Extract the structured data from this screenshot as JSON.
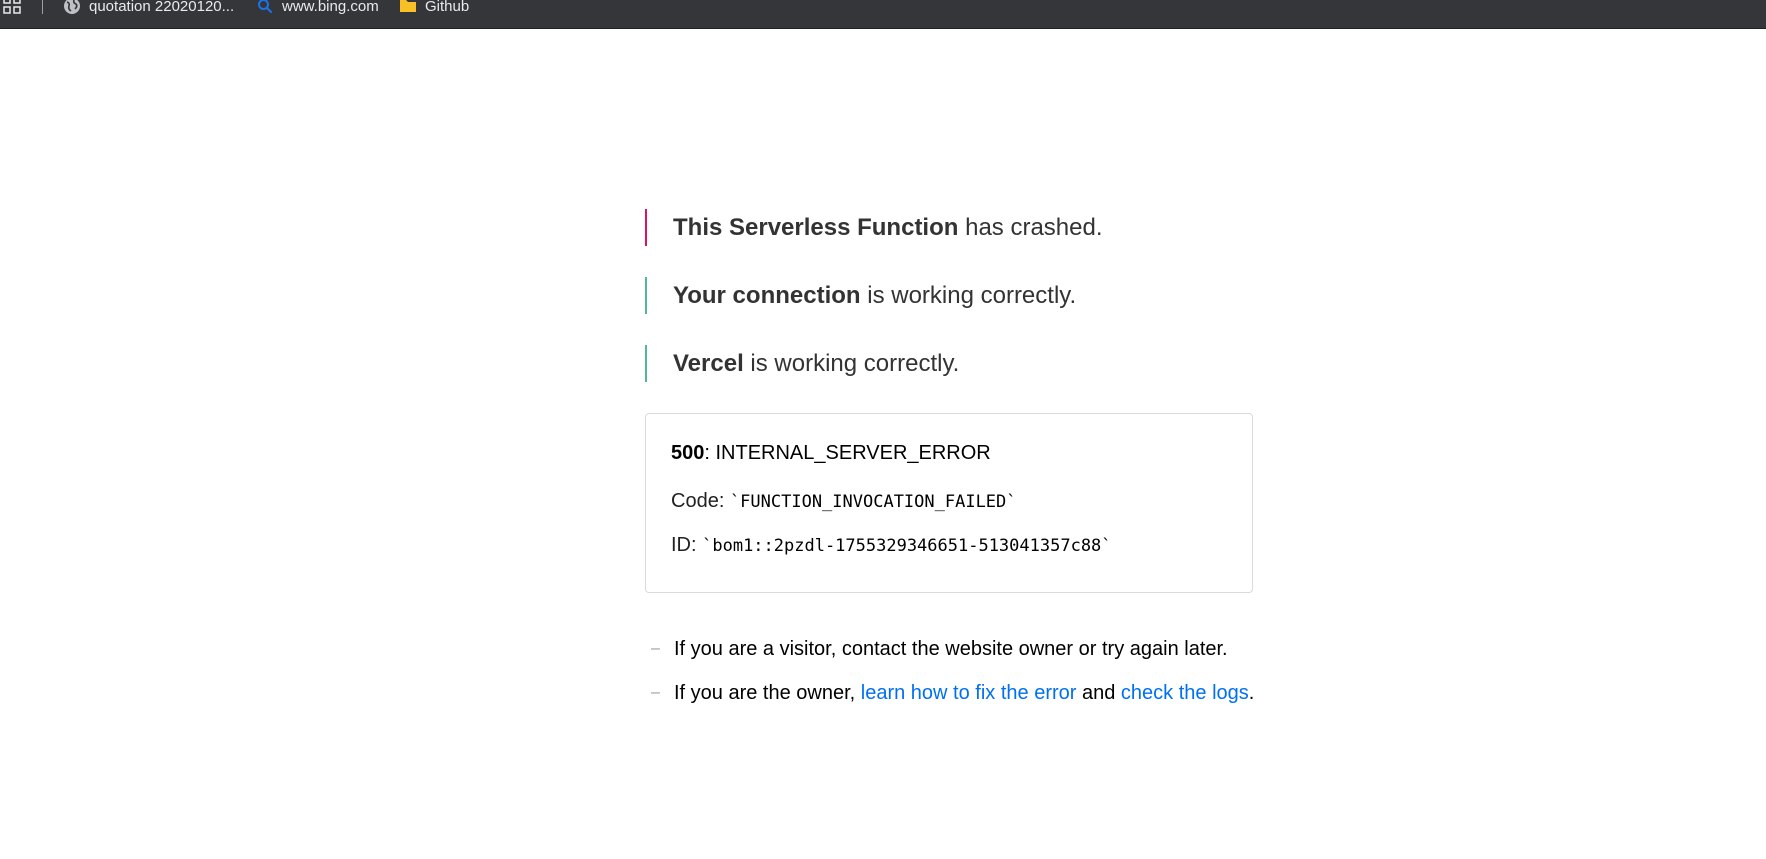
{
  "bookmarks_bar": {
    "items": [
      {
        "label": "quotation 22020120...",
        "icon": "globe-icon"
      },
      {
        "label": "www.bing.com",
        "icon": "search-icon"
      },
      {
        "label": "Github",
        "icon": "folder-icon"
      }
    ],
    "colors": {
      "bar_background": "#35363a",
      "text": "#e8eaed",
      "search_icon": "#1a73e8",
      "folder_icon": "#f6c026"
    }
  },
  "statuses": [
    {
      "bold": "This Serverless Function",
      "rest": " has crashed.",
      "bar_color": "#e0115f"
    },
    {
      "bold": "Your connection",
      "rest": " is working correctly.",
      "bar_color": "#50b893"
    },
    {
      "bold": "Vercel",
      "rest": " is working correctly.",
      "bar_color": "#50b893"
    }
  ],
  "error": {
    "code": "500",
    "message": ": INTERNAL_SERVER_ERROR",
    "code_label": "Code: ",
    "code_value": "`FUNCTION_INVOCATION_FAILED`",
    "id_label": "ID: ",
    "id_value": "`bom1::2pzdl-1755329346651-513041357c88`"
  },
  "help": {
    "dash": "–",
    "visitor_text": "If you are a visitor, contact the website owner or try again later.",
    "owner_prefix": "If you are the owner, ",
    "fix_link": "learn how to fix the error",
    "and_text": " and ",
    "logs_link": "check the logs",
    "period": ".",
    "link_color": "#0070f3"
  }
}
